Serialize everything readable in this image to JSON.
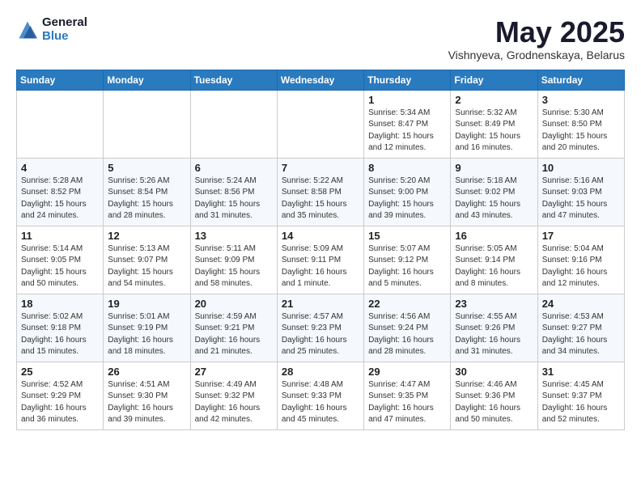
{
  "logo": {
    "general": "General",
    "blue": "Blue"
  },
  "title": {
    "month_year": "May 2025",
    "location": "Vishnyeva, Grodnenskaya, Belarus"
  },
  "weekdays": [
    "Sunday",
    "Monday",
    "Tuesday",
    "Wednesday",
    "Thursday",
    "Friday",
    "Saturday"
  ],
  "rows": [
    [
      {
        "day": "",
        "sunrise": "",
        "sunset": "",
        "daylight": ""
      },
      {
        "day": "",
        "sunrise": "",
        "sunset": "",
        "daylight": ""
      },
      {
        "day": "",
        "sunrise": "",
        "sunset": "",
        "daylight": ""
      },
      {
        "day": "",
        "sunrise": "",
        "sunset": "",
        "daylight": ""
      },
      {
        "day": "1",
        "sunrise": "Sunrise: 5:34 AM",
        "sunset": "Sunset: 8:47 PM",
        "daylight": "Daylight: 15 hours and 12 minutes."
      },
      {
        "day": "2",
        "sunrise": "Sunrise: 5:32 AM",
        "sunset": "Sunset: 8:49 PM",
        "daylight": "Daylight: 15 hours and 16 minutes."
      },
      {
        "day": "3",
        "sunrise": "Sunrise: 5:30 AM",
        "sunset": "Sunset: 8:50 PM",
        "daylight": "Daylight: 15 hours and 20 minutes."
      }
    ],
    [
      {
        "day": "4",
        "sunrise": "Sunrise: 5:28 AM",
        "sunset": "Sunset: 8:52 PM",
        "daylight": "Daylight: 15 hours and 24 minutes."
      },
      {
        "day": "5",
        "sunrise": "Sunrise: 5:26 AM",
        "sunset": "Sunset: 8:54 PM",
        "daylight": "Daylight: 15 hours and 28 minutes."
      },
      {
        "day": "6",
        "sunrise": "Sunrise: 5:24 AM",
        "sunset": "Sunset: 8:56 PM",
        "daylight": "Daylight: 15 hours and 31 minutes."
      },
      {
        "day": "7",
        "sunrise": "Sunrise: 5:22 AM",
        "sunset": "Sunset: 8:58 PM",
        "daylight": "Daylight: 15 hours and 35 minutes."
      },
      {
        "day": "8",
        "sunrise": "Sunrise: 5:20 AM",
        "sunset": "Sunset: 9:00 PM",
        "daylight": "Daylight: 15 hours and 39 minutes."
      },
      {
        "day": "9",
        "sunrise": "Sunrise: 5:18 AM",
        "sunset": "Sunset: 9:02 PM",
        "daylight": "Daylight: 15 hours and 43 minutes."
      },
      {
        "day": "10",
        "sunrise": "Sunrise: 5:16 AM",
        "sunset": "Sunset: 9:03 PM",
        "daylight": "Daylight: 15 hours and 47 minutes."
      }
    ],
    [
      {
        "day": "11",
        "sunrise": "Sunrise: 5:14 AM",
        "sunset": "Sunset: 9:05 PM",
        "daylight": "Daylight: 15 hours and 50 minutes."
      },
      {
        "day": "12",
        "sunrise": "Sunrise: 5:13 AM",
        "sunset": "Sunset: 9:07 PM",
        "daylight": "Daylight: 15 hours and 54 minutes."
      },
      {
        "day": "13",
        "sunrise": "Sunrise: 5:11 AM",
        "sunset": "Sunset: 9:09 PM",
        "daylight": "Daylight: 15 hours and 58 minutes."
      },
      {
        "day": "14",
        "sunrise": "Sunrise: 5:09 AM",
        "sunset": "Sunset: 9:11 PM",
        "daylight": "Daylight: 16 hours and 1 minute."
      },
      {
        "day": "15",
        "sunrise": "Sunrise: 5:07 AM",
        "sunset": "Sunset: 9:12 PM",
        "daylight": "Daylight: 16 hours and 5 minutes."
      },
      {
        "day": "16",
        "sunrise": "Sunrise: 5:05 AM",
        "sunset": "Sunset: 9:14 PM",
        "daylight": "Daylight: 16 hours and 8 minutes."
      },
      {
        "day": "17",
        "sunrise": "Sunrise: 5:04 AM",
        "sunset": "Sunset: 9:16 PM",
        "daylight": "Daylight: 16 hours and 12 minutes."
      }
    ],
    [
      {
        "day": "18",
        "sunrise": "Sunrise: 5:02 AM",
        "sunset": "Sunset: 9:18 PM",
        "daylight": "Daylight: 16 hours and 15 minutes."
      },
      {
        "day": "19",
        "sunrise": "Sunrise: 5:01 AM",
        "sunset": "Sunset: 9:19 PM",
        "daylight": "Daylight: 16 hours and 18 minutes."
      },
      {
        "day": "20",
        "sunrise": "Sunrise: 4:59 AM",
        "sunset": "Sunset: 9:21 PM",
        "daylight": "Daylight: 16 hours and 21 minutes."
      },
      {
        "day": "21",
        "sunrise": "Sunrise: 4:57 AM",
        "sunset": "Sunset: 9:23 PM",
        "daylight": "Daylight: 16 hours and 25 minutes."
      },
      {
        "day": "22",
        "sunrise": "Sunrise: 4:56 AM",
        "sunset": "Sunset: 9:24 PM",
        "daylight": "Daylight: 16 hours and 28 minutes."
      },
      {
        "day": "23",
        "sunrise": "Sunrise: 4:55 AM",
        "sunset": "Sunset: 9:26 PM",
        "daylight": "Daylight: 16 hours and 31 minutes."
      },
      {
        "day": "24",
        "sunrise": "Sunrise: 4:53 AM",
        "sunset": "Sunset: 9:27 PM",
        "daylight": "Daylight: 16 hours and 34 minutes."
      }
    ],
    [
      {
        "day": "25",
        "sunrise": "Sunrise: 4:52 AM",
        "sunset": "Sunset: 9:29 PM",
        "daylight": "Daylight: 16 hours and 36 minutes."
      },
      {
        "day": "26",
        "sunrise": "Sunrise: 4:51 AM",
        "sunset": "Sunset: 9:30 PM",
        "daylight": "Daylight: 16 hours and 39 minutes."
      },
      {
        "day": "27",
        "sunrise": "Sunrise: 4:49 AM",
        "sunset": "Sunset: 9:32 PM",
        "daylight": "Daylight: 16 hours and 42 minutes."
      },
      {
        "day": "28",
        "sunrise": "Sunrise: 4:48 AM",
        "sunset": "Sunset: 9:33 PM",
        "daylight": "Daylight: 16 hours and 45 minutes."
      },
      {
        "day": "29",
        "sunrise": "Sunrise: 4:47 AM",
        "sunset": "Sunset: 9:35 PM",
        "daylight": "Daylight: 16 hours and 47 minutes."
      },
      {
        "day": "30",
        "sunrise": "Sunrise: 4:46 AM",
        "sunset": "Sunset: 9:36 PM",
        "daylight": "Daylight: 16 hours and 50 minutes."
      },
      {
        "day": "31",
        "sunrise": "Sunrise: 4:45 AM",
        "sunset": "Sunset: 9:37 PM",
        "daylight": "Daylight: 16 hours and 52 minutes."
      }
    ]
  ]
}
